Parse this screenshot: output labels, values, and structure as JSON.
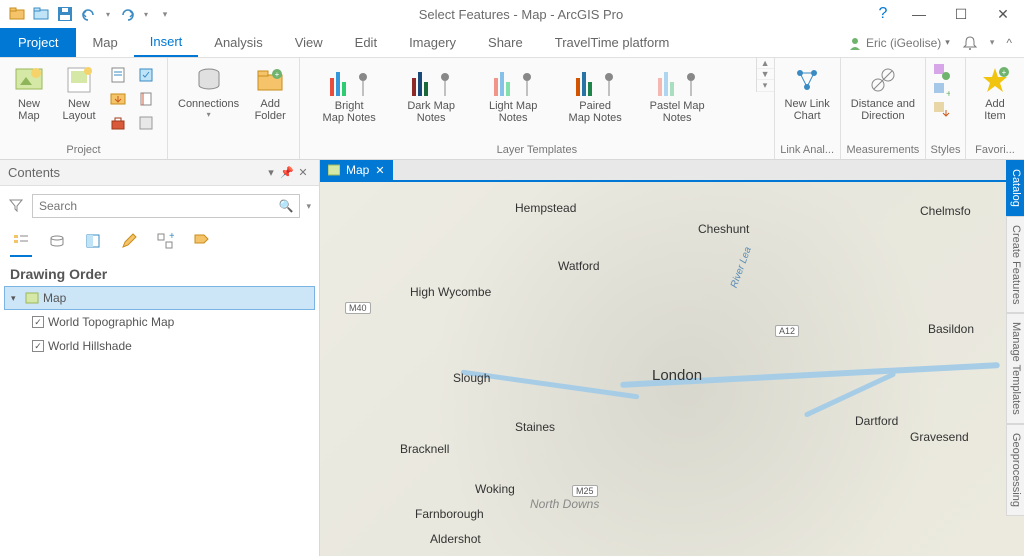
{
  "titlebar": {
    "title": "Select Features - Map - ArcGIS Pro"
  },
  "user": {
    "name": "Eric (iGeolise)"
  },
  "ribbon": {
    "file_tab": "Project",
    "tabs": [
      "Map",
      "Insert",
      "Analysis",
      "View",
      "Edit",
      "Imagery",
      "Share",
      "TravelTime platform"
    ],
    "active_tab": "Insert",
    "groups": {
      "project": {
        "label": "Project",
        "new_map": "New\nMap",
        "new_layout": "New\nLayout",
        "connections": "Connections",
        "add_folder": "Add\nFolder"
      },
      "layer_templates": {
        "label": "Layer Templates",
        "items": [
          "Bright\nMap Notes",
          "Dark Map\nNotes",
          "Light Map\nNotes",
          "Paired\nMap Notes",
          "Pastel Map\nNotes"
        ]
      },
      "link_analysis": {
        "label": "Link Anal...",
        "new_link_chart": "New Link\nChart"
      },
      "measurements": {
        "label": "Measurements",
        "distance_direction": "Distance and\nDirection"
      },
      "styles": {
        "label": "Styles"
      },
      "favorites": {
        "label": "Favori...",
        "add_item": "Add\nItem"
      }
    }
  },
  "contents": {
    "title": "Contents",
    "search_placeholder": "Search",
    "section": "Drawing Order",
    "tree": {
      "root": "Map",
      "layers": [
        "World Topographic Map",
        "World Hillshade"
      ]
    }
  },
  "map_view": {
    "tab_label": "Map",
    "cities": {
      "london": "London",
      "watford": "Watford",
      "hempstead": "Hempstead",
      "cheshunt": "Cheshunt",
      "chelmsford": "Chelmsfo",
      "basildon": "Basildon",
      "dartford": "Dartford",
      "gravesend": "Gravesend",
      "slough": "Slough",
      "high_wycombe": "High Wycombe",
      "bracknell": "Bracknell",
      "staines": "Staines",
      "woking": "Woking",
      "farnborough": "Farnborough",
      "aldershot": "Aldershot",
      "north_downs": "North Downs",
      "river_lea": "River Lea"
    },
    "shields": {
      "m40": "M40",
      "a12": "A12",
      "m25": "M25"
    }
  },
  "side_tabs": [
    "Catalog",
    "Create Features",
    "Manage Templates",
    "Geoprocessing"
  ]
}
